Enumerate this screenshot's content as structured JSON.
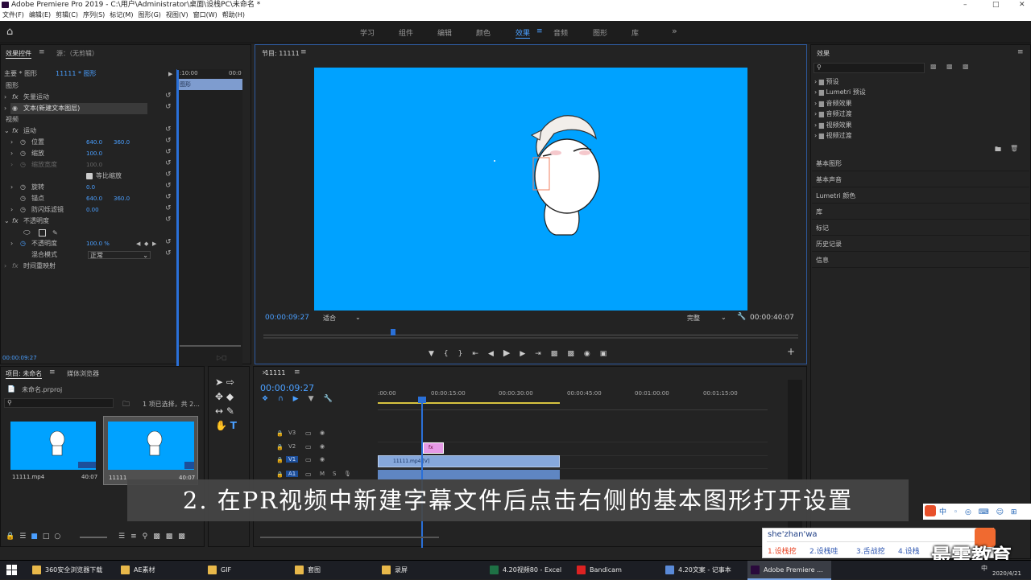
{
  "app": {
    "title": "Adobe Premiere Pro 2019 - C:\\用户\\Administrator\\桌面\\设栈PC\\未命名 *",
    "menu": [
      "文件(F)",
      "编辑(E)",
      "剪辑(C)",
      "序列(S)",
      "标记(M)",
      "图形(G)",
      "视图(V)",
      "窗口(W)",
      "帮助(H)"
    ]
  },
  "workspaces": [
    "学习",
    "组件",
    "编辑",
    "颜色",
    "效果",
    "音频",
    "图形",
    "库"
  ],
  "colors": {
    "accent": "#4a9fff",
    "program_bg": "#00a2ff",
    "caption_bg": "#464646"
  },
  "effect_controls": {
    "tab_active": "效果控件",
    "tab_source": "源：（无剪辑）",
    "master": "主要 * 图形",
    "clip": "11111 * 图形",
    "mini_time_start": ":10:00",
    "mini_time_end": "00:0",
    "graphic_clip": "图形",
    "section_graphic": "图形",
    "vector_motion": "矢量运动",
    "text_layer": "文本(新建文本图层)",
    "section_video": "视频",
    "motion": "运动",
    "position_label": "位置",
    "position_x": "640.0",
    "position_y": "360.0",
    "scale_label": "缩放",
    "scale_val": "100.0",
    "scale_width_label": "缩放宽度",
    "scale_width_val": "100.0",
    "uniform_scale": "等比缩放",
    "rotation_label": "旋转",
    "rotation_val": "0.0",
    "anchor_label": "锚点",
    "anchor_x": "640.0",
    "anchor_y": "360.0",
    "antiflicker_label": "防闪烁滤镜",
    "antiflicker_val": "0.00",
    "opacity_section": "不透明度",
    "opacity_label": "不透明度",
    "opacity_val": "100.0 %",
    "blend_label": "混合模式",
    "blend_val": "正常",
    "time_remap": "时间重映射",
    "timecode": "00:00:09:27"
  },
  "program": {
    "title": "节目: 11111",
    "timecode_current": "00:00:09:27",
    "fit": "适合",
    "quality": "完整",
    "timecode_total": "00:00:40:07"
  },
  "effects_panel": {
    "title": "效果",
    "tree": [
      "预设",
      "Lumetri 预设",
      "音频效果",
      "音频过渡",
      "视频效果",
      "视频过渡"
    ],
    "sections": [
      "基本图形",
      "基本声音",
      "Lumetri 颜色",
      "库",
      "标记",
      "历史记录",
      "信息"
    ]
  },
  "project": {
    "tab_active": "项目: 未命名",
    "tab_media": "媒体浏览器",
    "file": "未命名.prproj",
    "selection": "1 项已选择，共 2...",
    "items": [
      {
        "name": "11111.mp4",
        "duration": "40:07"
      },
      {
        "name": "11111",
        "duration": "40:07"
      }
    ]
  },
  "timeline": {
    "title": "11111",
    "timecode": "00:00:09:27",
    "ruler": [
      ":00:00",
      "00:00:15:00",
      "00:00:30:00",
      "00:00:45:00",
      "00:01:00:00",
      "00:01:15:00"
    ],
    "tracks": [
      "V3",
      "V2",
      "V1",
      "A1"
    ],
    "graphic_clip": "fx",
    "video_clip": "11111.mp4 [V]"
  },
  "caption": "2. 在PR视频中新建字幕文件后点击右侧的基本图形打开设置",
  "ime": {
    "pinyin": "she'zhan'wa",
    "candidates": [
      "1.设栈挖",
      "2.设栈哇",
      "3.舌战挖",
      "4.设栈"
    ]
  },
  "watermark": "最需教育",
  "taskbar": {
    "items": [
      "360安全浏览器下载",
      "AE素材",
      "GIF",
      "套图",
      "录屏",
      "4.20视频80 - Excel",
      "Bandicam",
      "4.20文案 - 记事本",
      "Adobe Premiere ..."
    ],
    "date": "2020/4/21",
    "ime_lang": "中"
  }
}
